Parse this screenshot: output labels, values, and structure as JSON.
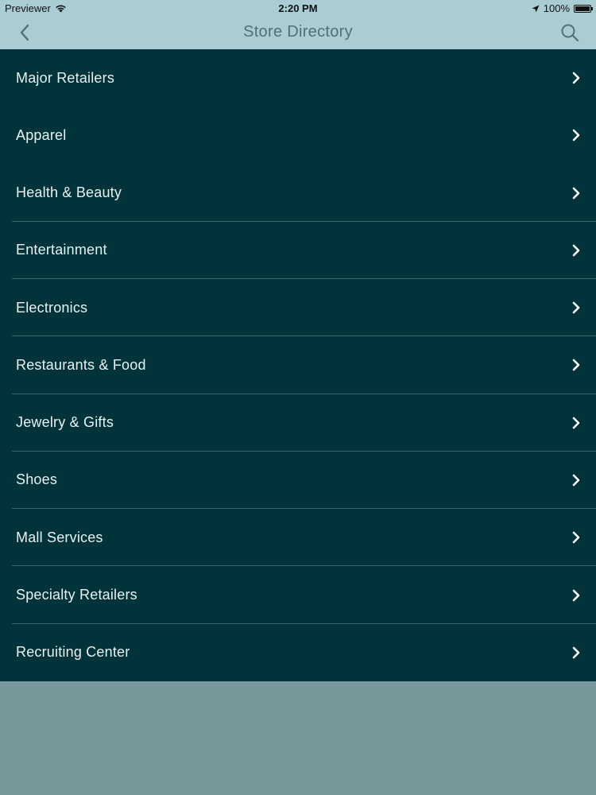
{
  "status_bar": {
    "carrier": "Previewer",
    "time": "2:20 PM",
    "battery": "100%"
  },
  "nav": {
    "title": "Store Directory",
    "back_icon": "chevron-left-icon",
    "search_icon": "search-icon"
  },
  "colors": {
    "nav_bg": "#a9cdd2",
    "list_bg": "#01343a",
    "page_bg": "#77979a",
    "text": "#e9f1f1"
  },
  "categories": [
    {
      "label": "Major Retailers"
    },
    {
      "label": "Apparel"
    },
    {
      "label": "Health & Beauty"
    },
    {
      "label": "Entertainment"
    },
    {
      "label": "Electronics"
    },
    {
      "label": "Restaurants & Food"
    },
    {
      "label": "Jewelry & Gifts"
    },
    {
      "label": "Shoes"
    },
    {
      "label": "Mall Services"
    },
    {
      "label": "Specialty Retailers"
    },
    {
      "label": "Recruiting Center"
    }
  ]
}
